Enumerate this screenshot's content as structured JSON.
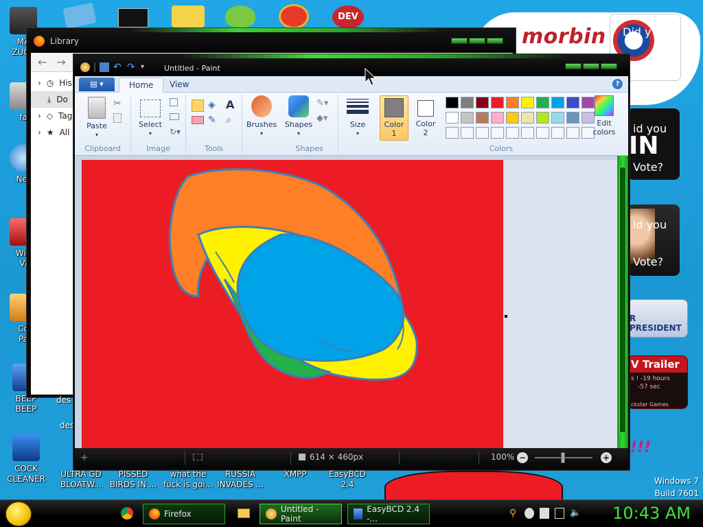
{
  "desktop": {
    "icons_left": [
      {
        "label": "MA\nZUCK",
        "color": "#444"
      },
      {
        "label": "fa",
        "color": "#666"
      },
      {
        "label": "Net",
        "color": "#2d7fd0"
      },
      {
        "label": "Win\nVi",
        "color": "#b22"
      },
      {
        "label": "Co\nPa",
        "color": "#e8a22a"
      },
      {
        "label": "BEEP\nBEEP",
        "color": "#1f5fb0"
      },
      {
        "label": "COCK\nCLEANER",
        "color": "#1e6cc8"
      }
    ],
    "icons_bottom": [
      {
        "label": "ULTRA GD\nBLOATW..."
      },
      {
        "label": "PISSED\nBIRDS IN ..."
      },
      {
        "label": "what the\nfuck is goi..."
      },
      {
        "label": "RUSSIA\nINVADES ..."
      },
      {
        "label": "XMPP"
      },
      {
        "label": "EasyBCD\n2.4"
      }
    ],
    "library_side_label": "des",
    "ads": {
      "morbin": "morbin t",
      "did_you_1": "Did y",
      "did_you_2": "id you",
      "in_text": "IN",
      "vote_1": "Vote?",
      "did_you_3": "id you",
      "vote_2": "Vote?",
      "president": "R PRESIDENT",
      "trailer": "V Trailer",
      "trailer_sub1": "s ! -19 hours",
      "trailer_sub2": "-57 sec",
      "trailer_sub3": "ckstar Games",
      "exclaim": "!!!"
    },
    "watermark": {
      "line1": "Windows 7",
      "line2": "Build 7601"
    }
  },
  "library": {
    "title": "Library",
    "tree": [
      {
        "label": "His",
        "icon": "history-icon"
      },
      {
        "label": "Do",
        "icon": "download-icon"
      },
      {
        "label": "Tag",
        "icon": "tag-icon"
      },
      {
        "label": "All",
        "icon": "star-icon"
      }
    ]
  },
  "paint": {
    "title": "Untitled - Paint",
    "tabs": {
      "home": "Home",
      "view": "View"
    },
    "groups": {
      "clipboard": "Clipboard",
      "image": "Image",
      "tools": "Tools",
      "shapes": "Shapes",
      "colors": "Colors"
    },
    "buttons": {
      "paste": "Paste",
      "select": "Select",
      "brushes": "Brushes",
      "shapes": "Shapes",
      "size": "Size",
      "color1": "Color\n1",
      "color2": "Color\n2",
      "edit_colors": "Edit\ncolors"
    },
    "palette_row1": [
      "#000000",
      "#7f7f7f",
      "#880015",
      "#ed1c24",
      "#ff7f27",
      "#fff200",
      "#22b14c",
      "#00a2e8",
      "#3f48cc",
      "#a349a4"
    ],
    "palette_row2": [
      "#ffffff",
      "#c3c3c3",
      "#b97a57",
      "#ffaec9",
      "#ffc90e",
      "#efe4b0",
      "#b5e61d",
      "#99d9ea",
      "#7092be",
      "#c8bfe7"
    ],
    "color1": "#7f7f7f",
    "color2": "#ffffff",
    "canvas_size": "614 × 460px",
    "zoom": "100%",
    "canvas_colors": {
      "bg": "#ed1c24",
      "orange": "#ff7f27",
      "yellow": "#fff200",
      "green": "#22b14c",
      "blue": "#00a2e8"
    }
  },
  "taskbar": {
    "items": [
      {
        "label": "Firefox"
      },
      {
        "label": "Untitled - Paint"
      },
      {
        "label": "EasyBCD 2.4 -..."
      }
    ],
    "clock": "10:43 AM"
  }
}
